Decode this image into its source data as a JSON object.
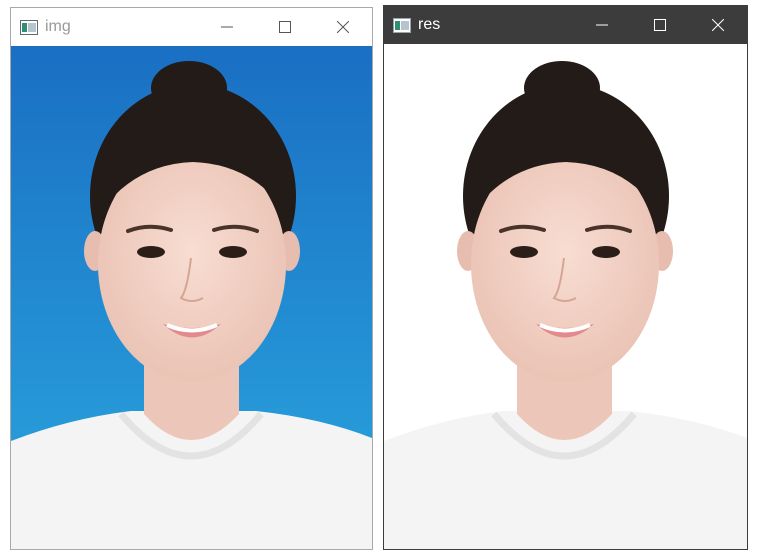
{
  "windows": [
    {
      "title": "img",
      "icon": "opencv-window-icon",
      "controls": [
        "minimize-icon",
        "maximize-icon",
        "close-icon"
      ],
      "image": {
        "kind": "portrait-photo",
        "background": "blue-gradient"
      }
    },
    {
      "title": "res",
      "icon": "opencv-window-icon",
      "controls": [
        "minimize-icon",
        "maximize-icon",
        "close-icon"
      ],
      "image": {
        "kind": "portrait-photo",
        "background": "white"
      }
    }
  ],
  "colors": {
    "blue_top": "#1c78c8",
    "blue_bottom": "#2aa4de",
    "skin": "#f2d3c6",
    "hair": "#221b18",
    "shirt": "#f4f4f4",
    "lips": "#e38a8e",
    "dark_titlebar": "#3c3c3c"
  }
}
